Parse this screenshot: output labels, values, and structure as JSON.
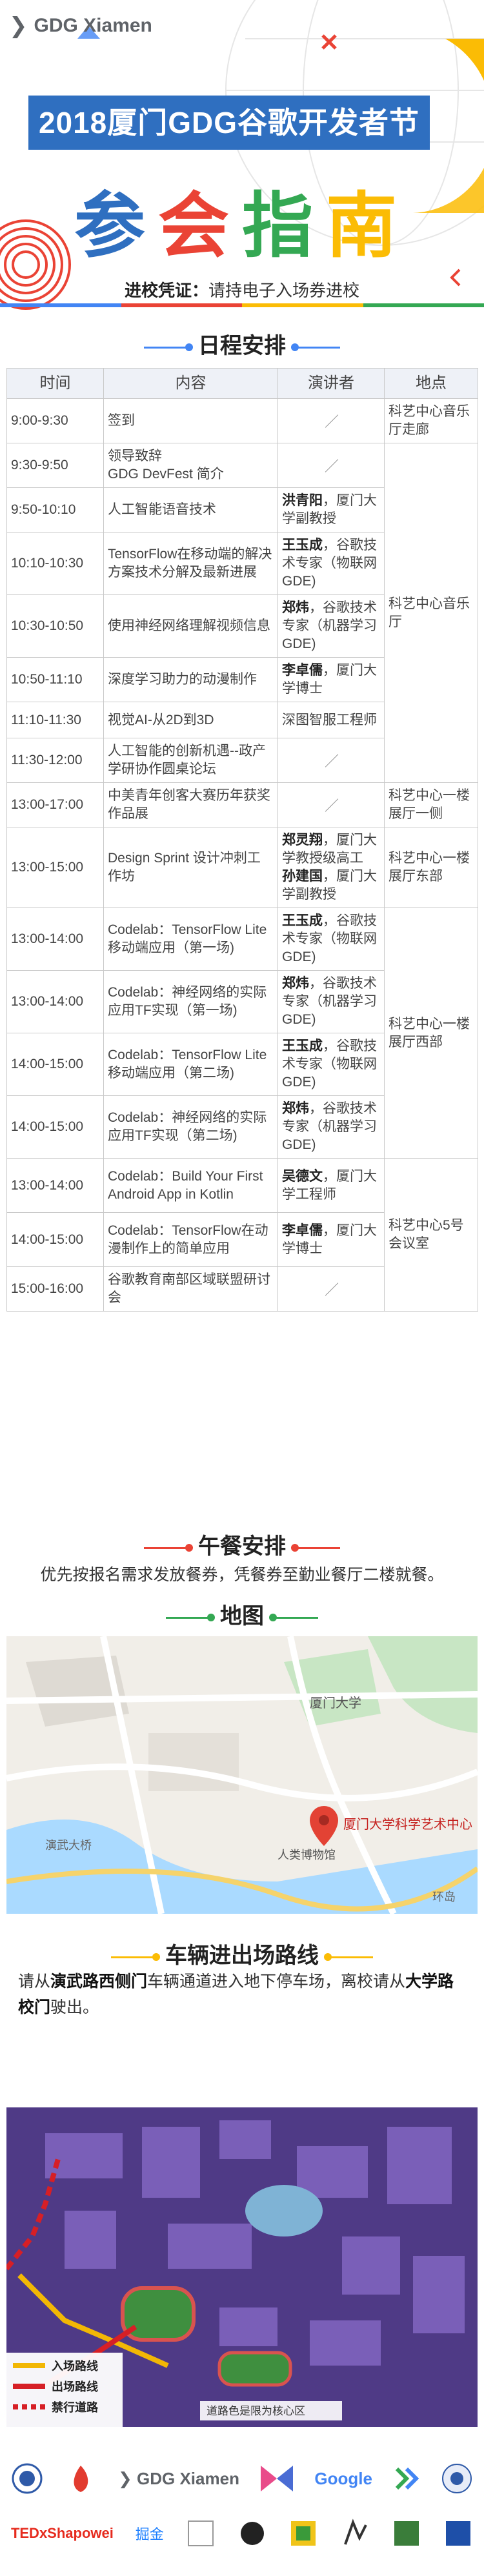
{
  "header": {
    "brand": "GDG Xiamen",
    "banner": "2018厦门GDG谷歌开发者节",
    "title_chars": [
      "参",
      "会",
      "指",
      "南"
    ],
    "credential_label": "进校凭证：",
    "credential_text": "请持电子入场券进校"
  },
  "schedule": {
    "heading": "日程安排",
    "columns": [
      "时间",
      "内容",
      "演讲者",
      "地点"
    ],
    "rows": [
      {
        "time": "9:00-9:30",
        "content": "签到",
        "speaker": "",
        "speaker_title": "",
        "slash": true
      },
      {
        "time": "9:30-9:50",
        "content": "领导致辞\nGDG DevFest 简介",
        "speaker": "",
        "speaker_title": "",
        "slash": true
      },
      {
        "time": "9:50-10:10",
        "content": "人工智能语音技术",
        "speaker": "洪青阳",
        "speaker_title": "，厦门大学副教授"
      },
      {
        "time": "10:10-10:30",
        "content": "TensorFlow在移动端的解决方案技术分解及最新进展",
        "speaker": "王玉成",
        "speaker_title": "，谷歌技术专家（物联网GDE)"
      },
      {
        "time": "10:30-10:50",
        "content": "使用神经网络理解视频信息",
        "speaker": "郑炜",
        "speaker_title": "，谷歌技术专家（机器学习GDE)"
      },
      {
        "time": "10:50-11:10",
        "content": "深度学习助力的动漫制作",
        "speaker": "李卓儒",
        "speaker_title": "，厦门大学博士"
      },
      {
        "time": "11:10-11:30",
        "content": "视觉AI-从2D到3D",
        "speaker": "",
        "speaker_title": "深图智服工程师"
      },
      {
        "time": "11:30-12:00",
        "content": "人工智能的创新机遇--政产学研协作圆桌论坛",
        "speaker": "",
        "speaker_title": "",
        "slash": true
      },
      {
        "time": "13:00-17:00",
        "content": "中美青年创客大赛历年获奖作品展",
        "speaker": "",
        "speaker_title": "",
        "slash": true
      },
      {
        "time": "13:00-15:00",
        "content": "Design Sprint 设计冲刺工作坊",
        "speaker": "郑灵翔",
        "speaker_title": "，厦门大学教授级高工",
        "speaker2": "孙建国",
        "speaker2_title": "，厦门大学副教授"
      },
      {
        "time": "13:00-14:00",
        "content": "Codelab：TensorFlow Lite移动端应用（第一场)",
        "speaker": "王玉成",
        "speaker_title": "，谷歌技术专家（物联网GDE)"
      },
      {
        "time": "13:00-14:00",
        "content": "Codelab：神经网络的实际应用TF实现（第一场)",
        "speaker": "郑炜",
        "speaker_title": "，谷歌技术专家（机器学习GDE)"
      },
      {
        "time": "14:00-15:00",
        "content": "Codelab：TensorFlow Lite移动端应用（第二场)",
        "speaker": "王玉成",
        "speaker_title": "，谷歌技术专家（物联网GDE)"
      },
      {
        "time": "14:00-15:00",
        "content": "Codelab：神经网络的实际应用TF实现（第二场)",
        "speaker": "郑炜",
        "speaker_title": "，谷歌技术专家（机器学习GDE)"
      },
      {
        "time": "13:00-14:00",
        "content": "Codelab：Build Your First Android App in Kotlin",
        "speaker": "吴德文",
        "speaker_title": "，厦门大学工程师"
      },
      {
        "time": "14:00-15:00",
        "content": "Codelab：TensorFlow在动漫制作上的简单应用",
        "speaker": "李卓儒",
        "speaker_title": "，厦门大学博士"
      },
      {
        "time": "15:00-16:00",
        "content": "谷歌教育南部区域联盟研讨会",
        "speaker": "",
        "speaker_title": "",
        "slash": true
      }
    ],
    "locations": [
      "科艺中心音乐厅走廊",
      "科艺中心音乐厅",
      "科艺中心一楼展厅一侧",
      "科艺中心一楼展厅东部",
      "科艺中心一楼展厅西部",
      "科艺中心5号会议室"
    ]
  },
  "lunch": {
    "heading": "午餐安排",
    "text": "优先按报名需求发放餐券，凭餐券至勤业餐厅二楼就餐。"
  },
  "map": {
    "heading": "地图",
    "labels": [
      "厦门大学",
      "厦门大学科学艺术中心",
      "人类博物馆",
      "演武大桥",
      "环岛"
    ]
  },
  "parking": {
    "heading": "车辆进出场路线",
    "text_a": "请从",
    "text_b": "演武路西侧门",
    "text_c": "车辆通道进入地下停车场，离校请从",
    "text_d": "大学路校门",
    "text_e": "驶出。",
    "legend": [
      "入场路线",
      "出场路线",
      "禁行道路"
    ],
    "legend_note": "道路色是限为核心区",
    "colors": {
      "enter": "#f2b705",
      "exit": "#d61f26",
      "forbid": "#d61f26"
    }
  },
  "footer": {
    "row1": [
      "GDG Xiamen",
      "Google"
    ],
    "row2": [
      "TEDxShapowei",
      "掘金"
    ]
  },
  "colors": {
    "blue": "#4285f4",
    "red": "#ea4335",
    "yellow": "#fbbc05",
    "green": "#34a853",
    "banner": "#2f6fc0"
  }
}
